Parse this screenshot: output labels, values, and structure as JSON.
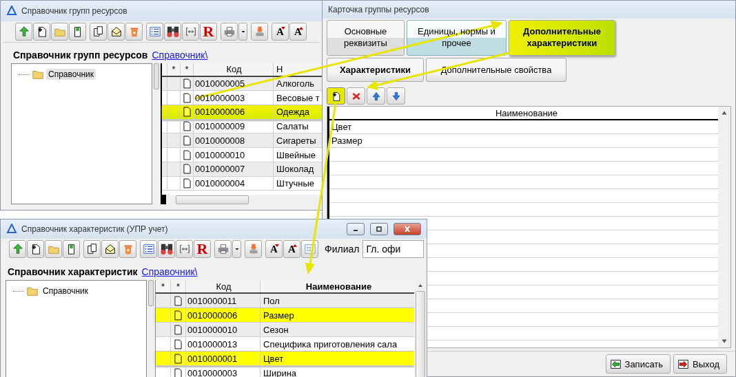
{
  "group_directory": {
    "title": "Справочник групп ресурсов",
    "toolbar": [
      [
        {
          "kind": "up"
        },
        {
          "kind": "new"
        },
        {
          "kind": "folder"
        },
        {
          "kind": "edit"
        }
      ],
      [
        {
          "kind": "copy"
        },
        {
          "kind": "mail"
        },
        {
          "kind": "delete"
        }
      ],
      [
        {
          "kind": "list"
        },
        {
          "kind": "find"
        },
        {
          "kind": "link"
        },
        {
          "kind": "report",
          "label": "R"
        }
      ],
      [
        {
          "kind": "print"
        },
        {
          "kind": "dropdown"
        }
      ],
      [
        {
          "kind": "export"
        }
      ],
      [
        {
          "kind": "font-up",
          "label": "A"
        },
        {
          "kind": "font-down",
          "label": "A"
        }
      ]
    ],
    "heading": "Справочник групп ресурсов",
    "breadcrumb": "Справочник\\",
    "tree": [
      {
        "label": "Справочник",
        "selected": true
      }
    ],
    "columns": [
      "*",
      "*",
      "Код",
      "Н"
    ],
    "rows": [
      {
        "code": "0010000005",
        "name": "Алкоголь",
        "selected": false
      },
      {
        "code": "0010000003",
        "name": "Весовые т",
        "selected": false
      },
      {
        "code": "0010000006",
        "name": "Одежда",
        "selected": true
      },
      {
        "code": "0010000009",
        "name": "Салаты",
        "selected": false
      },
      {
        "code": "0010000008",
        "name": "Сигареты",
        "selected": false
      },
      {
        "code": "0010000010",
        "name": "Швейные",
        "selected": false
      },
      {
        "code": "0010000007",
        "name": "Шоколад",
        "selected": false
      },
      {
        "code": "0010000004",
        "name": "Штучные",
        "selected": false
      }
    ]
  },
  "group_card": {
    "title": "Карточка группы ресурсов",
    "tabs": [
      {
        "label": "Основные реквизиты",
        "selected": false,
        "hovered": false
      },
      {
        "label": "Единицы, нормы и прочее",
        "selected": false,
        "hovered": true
      },
      {
        "label": "Дополнительные характеристики",
        "selected": true,
        "hovered": false
      }
    ],
    "subtabs": [
      {
        "label": "Характеристики",
        "selected": true
      },
      {
        "label": "Дополнительные свойства",
        "selected": false
      }
    ],
    "toolbar": [
      {
        "kind": "add",
        "highlighted": true
      },
      {
        "kind": "remove",
        "highlighted": false
      },
      {
        "kind": "move-up",
        "highlighted": false
      },
      {
        "kind": "move-down",
        "highlighted": false
      }
    ],
    "column": "Наименование",
    "rows": [
      "Цвет",
      "Размер"
    ],
    "buttons": [
      {
        "kind": "save",
        "label": "Записать"
      },
      {
        "kind": "exit",
        "label": "Выход"
      }
    ]
  },
  "characteristic_directory": {
    "title": "Справочник характеристик (УПР учет)",
    "toolbar": [
      [
        {
          "kind": "up"
        },
        {
          "kind": "new"
        },
        {
          "kind": "folder"
        },
        {
          "kind": "edit"
        }
      ],
      [
        {
          "kind": "copy"
        },
        {
          "kind": "mail"
        },
        {
          "kind": "delete"
        }
      ],
      [
        {
          "kind": "list"
        },
        {
          "kind": "find"
        },
        {
          "kind": "link"
        },
        {
          "kind": "report",
          "label": "R"
        }
      ],
      [
        {
          "kind": "print"
        },
        {
          "kind": "dropdown"
        }
      ],
      [
        {
          "kind": "export"
        }
      ],
      [
        {
          "kind": "font-up",
          "label": "A"
        },
        {
          "kind": "font-down",
          "label": "A"
        },
        {
          "kind": "calendar"
        }
      ]
    ],
    "filter": {
      "label": "Филиал",
      "value": "Гл. офи"
    },
    "heading": "Справочник характеристик",
    "breadcrumb": "Справочник\\",
    "tree": [
      {
        "label": "Справочник",
        "selected": false
      }
    ],
    "columns": [
      "*",
      "*",
      "Код",
      "Наименование"
    ],
    "rows": [
      {
        "code": "0010000011",
        "name": "Пол",
        "selected": false
      },
      {
        "code": "0010000006",
        "name": "Размер",
        "selected": true
      },
      {
        "code": "0010000010",
        "name": "Сезон",
        "selected": false
      },
      {
        "code": "0010000013",
        "name": "Специфика приготовления сала",
        "selected": false
      },
      {
        "code": "0010000001",
        "name": "Цвет",
        "selected": true
      },
      {
        "code": "0010000003",
        "name": "Ширина",
        "selected": false
      }
    ]
  }
}
